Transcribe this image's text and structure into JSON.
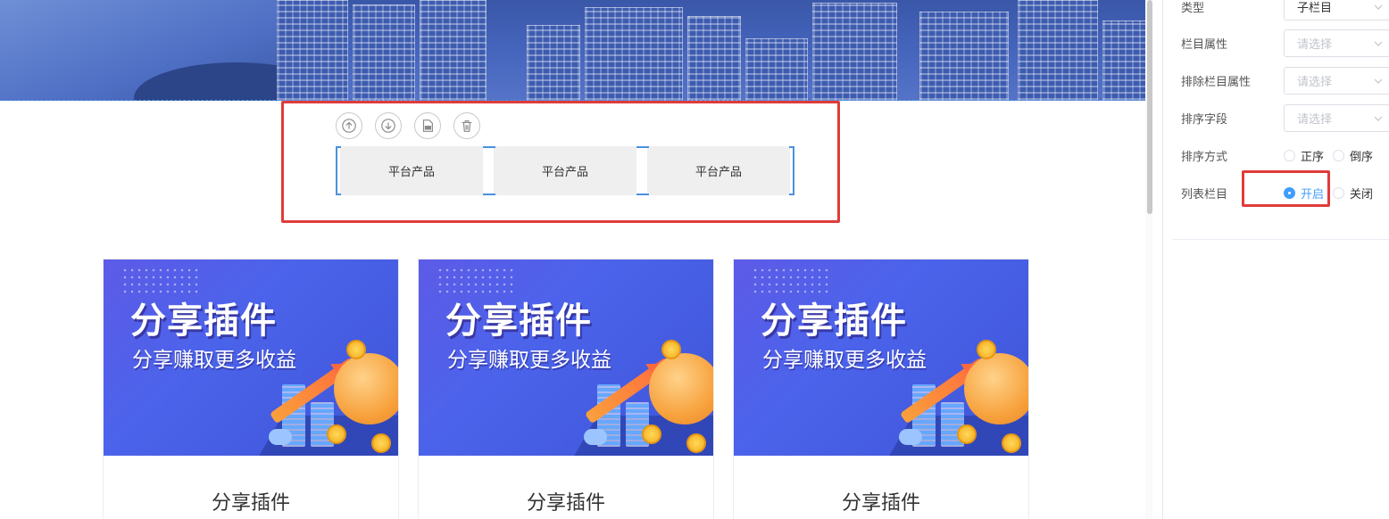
{
  "toolbar": {
    "icons": [
      "move-up-icon",
      "move-down-icon",
      "save-component-icon",
      "delete-icon"
    ]
  },
  "tabs": [
    "平台产品",
    "平台产品",
    "平台产品"
  ],
  "cards": [
    {
      "headline": "分享插件",
      "subline": "分享赚取更多收益",
      "title": "分享插件"
    },
    {
      "headline": "分享插件",
      "subline": "分享赚取更多收益",
      "title": "分享插件"
    },
    {
      "headline": "分享插件",
      "subline": "分享赚取更多收益",
      "title": "分享插件"
    }
  ],
  "panel": {
    "type_label": "类型",
    "type_value": "子栏目",
    "column_attr_label": "栏目属性",
    "column_attr_placeholder": "请选择",
    "exclude_attr_label": "排除栏目属性",
    "exclude_attr_placeholder": "请选择",
    "sort_field_label": "排序字段",
    "sort_field_placeholder": "请选择",
    "sort_order_label": "排序方式",
    "sort_asc": "正序",
    "sort_desc": "倒序",
    "list_column_label": "列表栏目",
    "list_on": "开启",
    "list_off": "关闭"
  },
  "colors": {
    "accent": "#409eff",
    "highlight": "#e03b3b",
    "selection": "#4a90e2"
  }
}
